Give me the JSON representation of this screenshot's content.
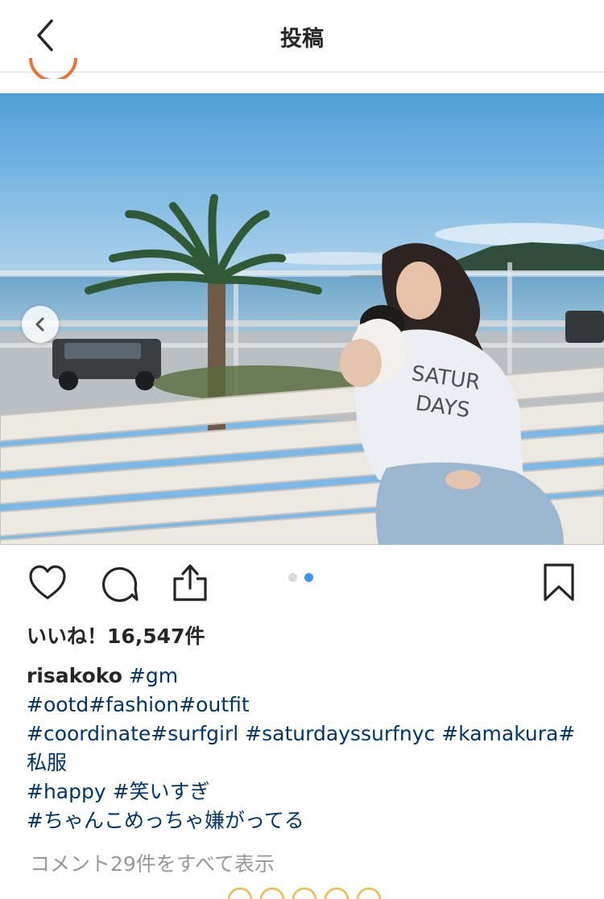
{
  "header": {
    "title": "投稿"
  },
  "post": {
    "likes": "いいね！16,547件",
    "username": "risakoko",
    "caption_lines": [
      [
        "#gm"
      ],
      [
        "#ootd#fashion#outfit"
      ],
      [
        "#coordinate#surfgirl #saturdayssurfnyc #kamakura#"
      ],
      [
        "私服"
      ],
      [
        "#happy #笑いすぎ"
      ],
      [
        "#ちゃんこめっちゃ嫌がってる"
      ]
    ],
    "view_comments": "コメント29件をすべて表示",
    "sweatshirt_text": [
      "SATUR",
      "DAYS"
    ]
  },
  "carousel": {
    "total": 2,
    "active_index": 1
  },
  "colors": {
    "tag": "#003569",
    "dot_active": "#3897f0",
    "dot_inactive": "#dbdbdb",
    "text": "#262626",
    "muted": "#999999"
  },
  "icons": {
    "back": "chevron-left-icon",
    "prev": "chevron-left-icon",
    "like": "heart-icon",
    "comment": "comment-icon",
    "share": "share-icon",
    "save": "bookmark-icon"
  }
}
